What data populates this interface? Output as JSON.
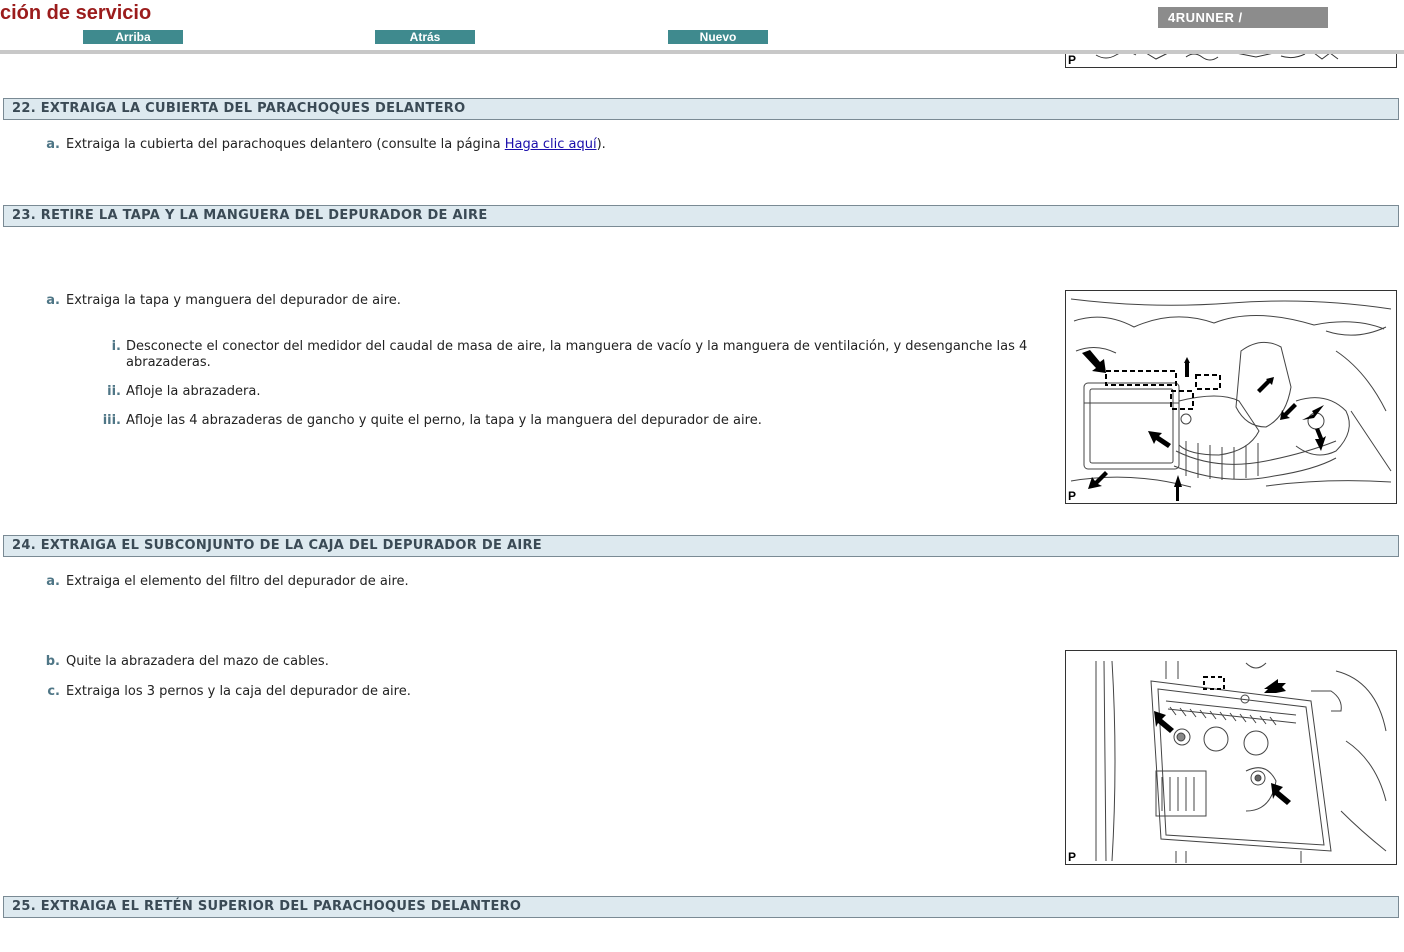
{
  "header": {
    "title": "ción de servicio",
    "nav": {
      "up": "Arriba",
      "back": "Atrás",
      "new": "Nuevo"
    },
    "model": "4RUNNER / "
  },
  "figure_label": "P",
  "sections": {
    "s22": {
      "title": "22. EXTRAIGA LA CUBIERTA DEL PARACHOQUES DELANTERO",
      "a_label": "a.",
      "a_text_before": "Extraiga la cubierta del parachoques delantero (consulte la página ",
      "a_link": "Haga clic aquí",
      "a_text_after": ")."
    },
    "s23": {
      "title": "23. RETIRE LA TAPA Y LA MANGUERA DEL DEPURADOR DE AIRE",
      "a_label": "a.",
      "a_text": "Extraiga la tapa y manguera del depurador de aire.",
      "i_label": "i.",
      "i_text": "Desconecte el conector del medidor del caudal de masa de aire, la manguera de vacío y la manguera de ventilación, y desenganche las 4 abrazaderas.",
      "ii_label": "ii.",
      "ii_text": "Afloje la abrazadera.",
      "iii_label": "iii.",
      "iii_text": "Afloje las 4 abrazaderas de gancho y quite el perno, la tapa y la manguera del depurador de aire."
    },
    "s24": {
      "title": "24. EXTRAIGA EL SUBCONJUNTO DE LA CAJA DEL DEPURADOR DE AIRE",
      "a_label": "a.",
      "a_text": "Extraiga el elemento del filtro del depurador de aire.",
      "b_label": "b.",
      "b_text": "Quite la abrazadera del mazo de cables.",
      "c_label": "c.",
      "c_text": "Extraiga los 3 pernos y la caja del depurador de aire."
    },
    "s25": {
      "title": "25. EXTRAIGA EL RETÉN SUPERIOR DEL PARACHOQUES DELANTERO"
    }
  }
}
